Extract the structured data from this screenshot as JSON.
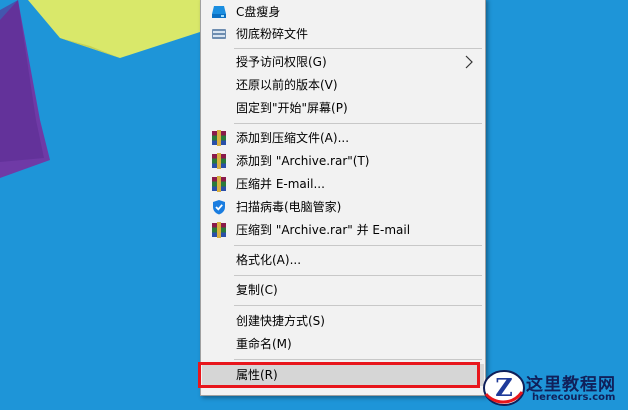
{
  "colors": {
    "desktop": "#1e95d8",
    "highlight_box": "#e8161c"
  },
  "menu": {
    "items": [
      {
        "label": "C盘瘦身",
        "icon": "drive-cleanup-icon"
      },
      {
        "label": "彻底粉碎文件",
        "icon": "shredder-icon"
      },
      {
        "label": "授予访问权限(G)",
        "icon": "",
        "submenu": true
      },
      {
        "label": "还原以前的版本(V)",
        "icon": ""
      },
      {
        "label": "固定到\"开始\"屏幕(P)",
        "icon": ""
      },
      {
        "label": "添加到压缩文件(A)...",
        "icon": "winrar-icon"
      },
      {
        "label": "添加到 \"Archive.rar\"(T)",
        "icon": "winrar-icon"
      },
      {
        "label": "压缩并 E-mail...",
        "icon": "winrar-icon"
      },
      {
        "label": "扫描病毒(电脑管家)",
        "icon": "shield-icon"
      },
      {
        "label": "压缩到 \"Archive.rar\" 并 E-mail",
        "icon": "winrar-icon"
      },
      {
        "label": "格式化(A)...",
        "icon": ""
      },
      {
        "label": "复制(C)",
        "icon": ""
      },
      {
        "label": "创建快捷方式(S)",
        "icon": ""
      },
      {
        "label": "重命名(M)",
        "icon": ""
      },
      {
        "label": "属性(R)",
        "icon": ""
      }
    ]
  },
  "watermark": {
    "title": "这里教程网",
    "url": "herecours.com",
    "logo_letter": "Z"
  }
}
